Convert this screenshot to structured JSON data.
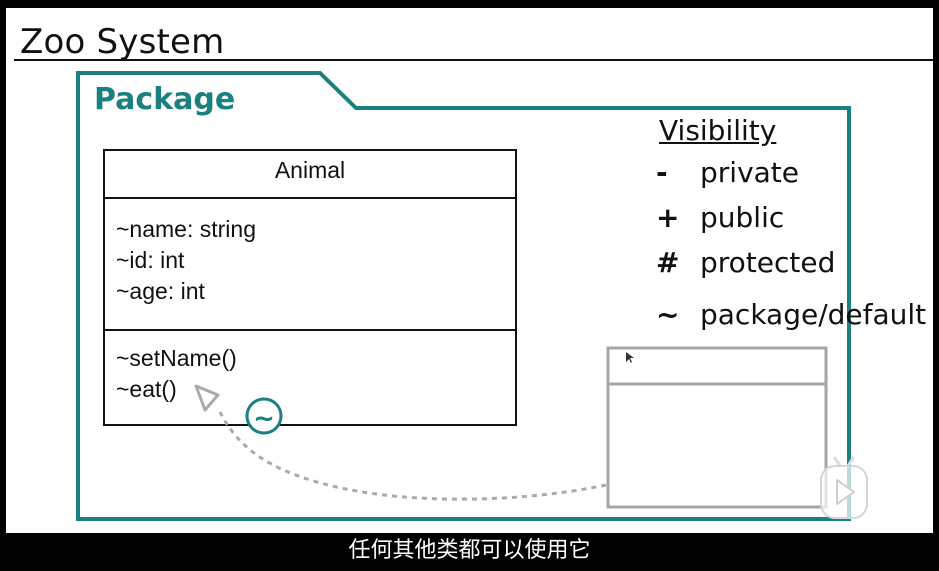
{
  "slide": {
    "title": "Zoo System"
  },
  "package": {
    "label": "Package"
  },
  "class": {
    "name": "Animal",
    "attributes": [
      "~name: string",
      "~id: int",
      "~age: int"
    ],
    "operations": [
      "~setName()",
      "~eat()"
    ]
  },
  "access_marker": {
    "symbol": "~"
  },
  "legend": {
    "title": "Visibility",
    "items": [
      {
        "symbol": "-",
        "label": "private"
      },
      {
        "symbol": "+",
        "label": "public"
      },
      {
        "symbol": "#",
        "label": "protected"
      },
      {
        "symbol": "~",
        "label": "package/default"
      }
    ]
  },
  "subtitle": "任何其他类都可以使用它",
  "colors": {
    "package_border": "#1b8080",
    "dependency_arrow": "#aaaaaa",
    "other_class_border": "#a6a6a6",
    "background": "#ffffff",
    "frame": "#000000"
  },
  "icons": {
    "player": "play-button-icon",
    "cursor": "mouse-cursor-icon"
  }
}
